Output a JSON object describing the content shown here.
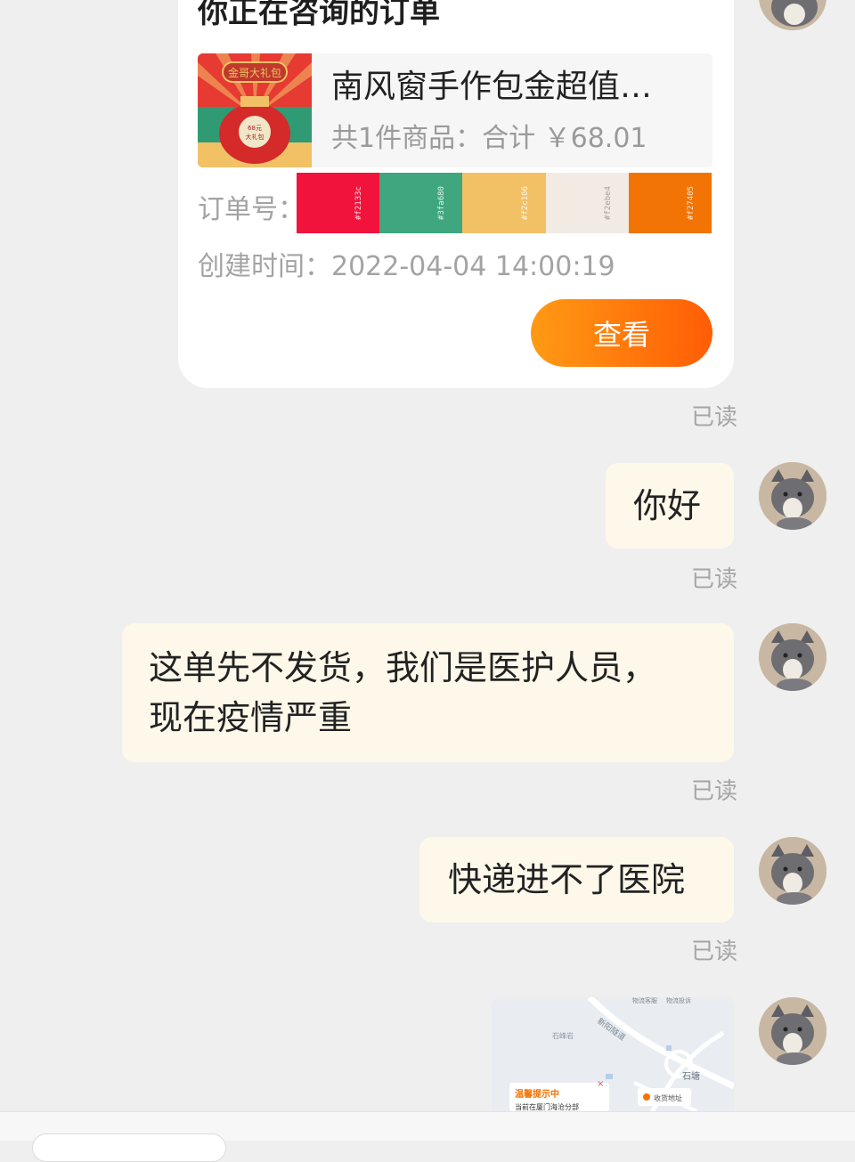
{
  "order_card": {
    "heading": "你正在咨询的订单",
    "product_title": "南风窗手作包金超值…",
    "product_summary": "共1件商品：合计 ￥68.01",
    "thumb_text_top": "金哥大礼包",
    "thumb_text_bag_1": "68元",
    "thumb_text_bag_2": "大礼包",
    "order_no_label": "订单号：",
    "swatches": [
      {
        "hex": "#f2133c",
        "label": "#f2133c"
      },
      {
        "hex": "#3fa680",
        "label": "#3fa680"
      },
      {
        "hex": "#f2c166",
        "label": "#f2c166"
      },
      {
        "hex": "#f2ebe4",
        "label": "#f2ebe4"
      },
      {
        "hex": "#f27405",
        "label": "#f27405"
      }
    ],
    "created_time": "创建时间：2022-04-04 14:00:19",
    "view_button": "查看"
  },
  "read_label": "已读",
  "messages": [
    {
      "text": "你好"
    },
    {
      "line1": "这单先不发货，我们是医护人员，",
      "line2": "现在疫情严重"
    },
    {
      "text": "快递进不了医院"
    }
  ],
  "map": {
    "label_road": "新阳隧道",
    "label_top_1": "物流客服",
    "label_top_2": "物流投诉",
    "label_area_1": "石峰岩",
    "label_area_2": "石塘",
    "label_collect": "收货地址",
    "tip_title": "温馨提示中",
    "tip_sub": "当前在厦门海沧分部"
  },
  "colors": {
    "background": "#efefef",
    "bubble": "#fdf8ea",
    "accent_start": "#ff9a14",
    "accent_end": "#ff5d05"
  }
}
